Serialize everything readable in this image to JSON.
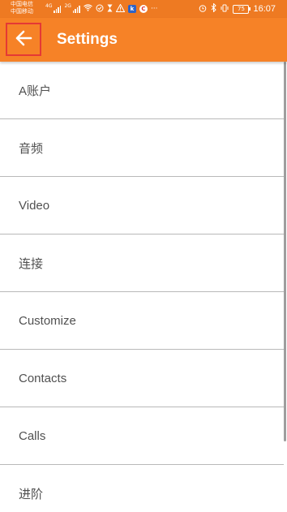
{
  "status_bar": {
    "carrier_1": "中国电信",
    "carrier_2": "中国移动",
    "net_1": "4G",
    "net_2": "2G",
    "battery": "75",
    "time": "16:07",
    "more": "···"
  },
  "app_bar": {
    "title": "Settings",
    "back_icon": "arrow-left-icon"
  },
  "settings": {
    "items": [
      {
        "label": "A账户"
      },
      {
        "label": "音频"
      },
      {
        "label": "Video"
      },
      {
        "label": "连接"
      },
      {
        "label": "Customize"
      },
      {
        "label": "Contacts"
      },
      {
        "label": "Calls"
      },
      {
        "label": "进阶"
      }
    ]
  },
  "colors": {
    "status_bar": "#ee7a22",
    "app_bar": "#f68227",
    "divider": "#b9b9b9",
    "highlight_border": "#e53935"
  }
}
